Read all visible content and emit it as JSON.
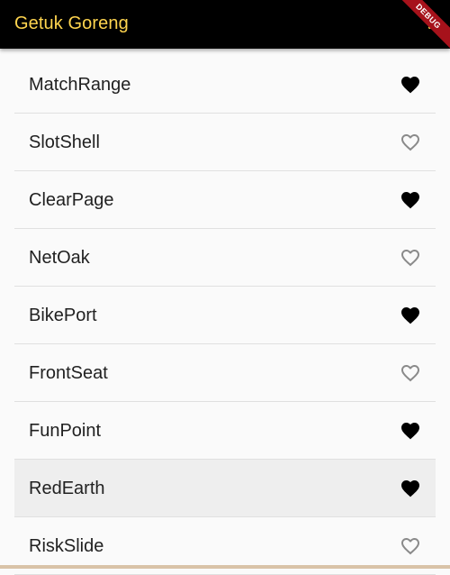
{
  "app_bar": {
    "title": "Getuk Goreng",
    "debug_banner": "DEBUG",
    "title_color": "#ffd54f",
    "background": "#000000"
  },
  "list": {
    "items": [
      {
        "label": "MatchRange",
        "favorite": true
      },
      {
        "label": "SlotShell",
        "favorite": false
      },
      {
        "label": "ClearPage",
        "favorite": true
      },
      {
        "label": "NetOak",
        "favorite": false
      },
      {
        "label": "BikePort",
        "favorite": true
      },
      {
        "label": "FrontSeat",
        "favorite": false
      },
      {
        "label": "FunPoint",
        "favorite": true
      },
      {
        "label": "RedEarth",
        "favorite": true,
        "highlighted": true
      },
      {
        "label": "RiskSlide",
        "favorite": false
      }
    ],
    "icons": {
      "favorite": "heart-filled-icon",
      "not_favorite": "heart-outline-icon"
    }
  }
}
